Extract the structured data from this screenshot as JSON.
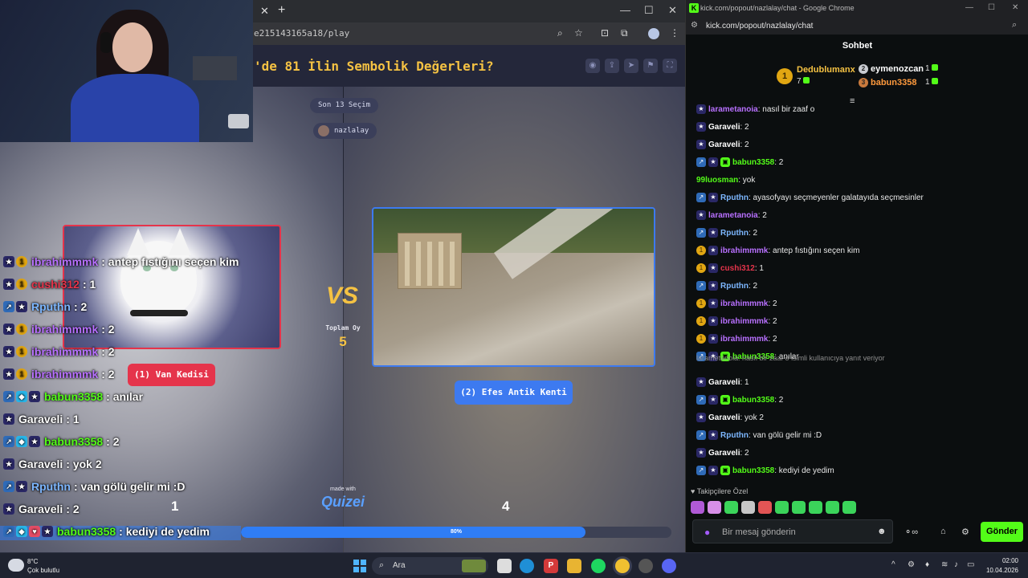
{
  "quiz": {
    "url": "e215143165a18/play",
    "title": "'de 81 İlin Sembolik Değerleri?",
    "last_selections": "Son 13 Seçim",
    "username": "nazlalay",
    "total_votes_label": "Toplam Oy",
    "total_votes": "5",
    "option_left": {
      "label": "(1) Van Kedisi",
      "votes": "1"
    },
    "option_right": {
      "label": "(2) Efes Antik Kenti",
      "votes": "4"
    },
    "progress_percent": 80,
    "progress_text": "80%",
    "made_with": "made with",
    "logo": "Quizei"
  },
  "overlay_chat": [
    {
      "user": "ibrahimmmk",
      "msg": ": antep fıstığını seçen kim",
      "color": "#b870ff",
      "badges": [
        "star",
        "coin"
      ]
    },
    {
      "user": "cushi312",
      "msg": ": 1",
      "color": "#e5344b",
      "badges": [
        "star",
        "coin"
      ]
    },
    {
      "user": "Rputhn",
      "msg": ": 2",
      "color": "#7db7ff",
      "badges": [
        "arrow",
        "star"
      ]
    },
    {
      "user": "ibrahimmmk",
      "msg": ": 2",
      "color": "#b870ff",
      "badges": [
        "star",
        "coin"
      ]
    },
    {
      "user": "ibrahimmmk",
      "msg": ": 2",
      "color": "#b870ff",
      "badges": [
        "star",
        "coin"
      ]
    },
    {
      "user": "ibrahimmmk",
      "msg": ": 2",
      "color": "#b870ff",
      "badges": [
        "star",
        "coin"
      ]
    },
    {
      "user": "babun3358",
      "msg": ": anılar",
      "color": "#53fc18",
      "badges": [
        "arrow",
        "cube",
        "star"
      ]
    },
    {
      "user": "Garaveli",
      "msg": ": 1",
      "color": "#ffffff",
      "badges": [
        "star"
      ]
    },
    {
      "user": "babun3358",
      "msg": ": 2",
      "color": "#53fc18",
      "badges": [
        "arrow",
        "cube",
        "star"
      ]
    },
    {
      "user": "Garaveli",
      "msg": ": yok 2",
      "color": "#ffffff",
      "badges": [
        "star"
      ]
    },
    {
      "user": "Rputhn",
      "msg": ": van gölü gelir mi :D",
      "color": "#7db7ff",
      "badges": [
        "arrow",
        "star"
      ]
    },
    {
      "user": "Garaveli",
      "msg": ": 2",
      "color": "#ffffff",
      "badges": [
        "star"
      ]
    },
    {
      "user": "babun3358",
      "msg": ": kediyi de yedim",
      "color": "#53fc18",
      "badges": [
        "arrow",
        "cube",
        "red",
        "star"
      ]
    }
  ],
  "kick": {
    "window_title": "kick.com/popout/nazlalay/chat - Google Chrome",
    "url": "kick.com/popout/nazlalay/chat",
    "chat_title": "Sohbet",
    "leaderboard": [
      {
        "rank": "1",
        "name": "Dedublumanx",
        "count": "7",
        "color": "#f5c243",
        "medal": "#e1a612"
      },
      {
        "rank": "2",
        "name": "eymenozcan",
        "count": "1",
        "color": "#ffffff",
        "medal": "#c9ccd2"
      },
      {
        "rank": "3",
        "name": "babun3358",
        "count": "1",
        "color": "#ff9a3d",
        "medal": "#c97a3d"
      }
    ],
    "messages": [
      {
        "user": "larametanoia",
        "msg": ": nasıl bir zaaf o",
        "color": "#b870ff",
        "badges": [
          "star"
        ]
      },
      {
        "user": "Garaveli",
        "msg": ": 2",
        "color": "#ffffff",
        "badges": [
          "star"
        ]
      },
      {
        "user": "Garaveli",
        "msg": ": 2",
        "color": "#ffffff",
        "badges": [
          "star"
        ]
      },
      {
        "user": "babun3358",
        "msg": ": 2",
        "color": "#53fc18",
        "badges": [
          "arrow",
          "star",
          "green"
        ]
      },
      {
        "user": "99luosman",
        "msg": ": yok",
        "color": "#53fc18",
        "badges": []
      },
      {
        "user": "Rputhn",
        "msg": ": ayasofyayı seçmeyenler galatayıda seçmesinler",
        "color": "#7db7ff",
        "badges": [
          "arrow",
          "star"
        ]
      },
      {
        "user": "larametanoia",
        "msg": ": 2",
        "color": "#b870ff",
        "badges": [
          "star"
        ]
      },
      {
        "user": "Rputhn",
        "msg": ": 2",
        "color": "#7db7ff",
        "badges": [
          "arrow",
          "star"
        ]
      },
      {
        "user": "ibrahimmmk",
        "msg": ": antep fıstığını seçen kim",
        "color": "#b870ff",
        "badges": [
          "coin",
          "star"
        ]
      },
      {
        "user": "cushi312",
        "msg": ": 1",
        "color": "#e5344b",
        "badges": [
          "coin",
          "star"
        ]
      },
      {
        "user": "Rputhn",
        "msg": ": 2",
        "color": "#7db7ff",
        "badges": [
          "arrow",
          "star"
        ]
      },
      {
        "user": "ibrahimmmk",
        "msg": ": 2",
        "color": "#b870ff",
        "badges": [
          "coin",
          "star"
        ]
      },
      {
        "user": "ibrahimmmk",
        "msg": ": 2",
        "color": "#b870ff",
        "badges": [
          "coin",
          "star"
        ]
      },
      {
        "user": "ibrahimmmk",
        "msg": ": 2",
        "color": "#b870ff",
        "badges": [
          "coin",
          "star"
        ]
      },
      {
        "user": "babun3358",
        "msg": ": anılar",
        "color": "#53fc18",
        "badges": [
          "arrow",
          "star",
          "green"
        ]
      },
      {
        "user": "Garaveli",
        "msg": ": 1",
        "color": "#ffffff",
        "badges": [
          "star"
        ]
      },
      {
        "user": "babun3358",
        "msg": ": 2",
        "color": "#53fc18",
        "badges": [
          "arrow",
          "star",
          "green"
        ]
      },
      {
        "user": "Garaveli",
        "msg": ": yok 2",
        "color": "#ffffff",
        "badges": [
          "star"
        ]
      },
      {
        "user": "Rputhn",
        "msg": ": van gölü gelir mi :D",
        "color": "#7db7ff",
        "badges": [
          "arrow",
          "star"
        ]
      },
      {
        "user": "Garaveli",
        "msg": ": 2",
        "color": "#ffffff",
        "badges": [
          "star"
        ]
      },
      {
        "user": "babun3358",
        "msg": ": kediyi de yedim",
        "color": "#53fc18",
        "badges": [
          "arrow",
          "star",
          "green"
        ]
      }
    ],
    "reply_note": "larametanoia: nasıl bir zaaf o isimli kullanıcıya yanıt veriyor",
    "follower_label": "Takipçilere Özel",
    "input_placeholder": "Bir mesaj gönderin",
    "send_label": "Gönder"
  },
  "taskbar": {
    "weather_temp": "8°C",
    "weather_desc": "Çok bulutlu",
    "search_placeholder": "Ara",
    "time": "02:00",
    "date": "10.04.2026"
  },
  "colors": {
    "kick_green": "#53fc18",
    "quiz_red": "#e5344b",
    "quiz_blue": "#3d7af0",
    "quiz_gold": "#f5c243"
  }
}
